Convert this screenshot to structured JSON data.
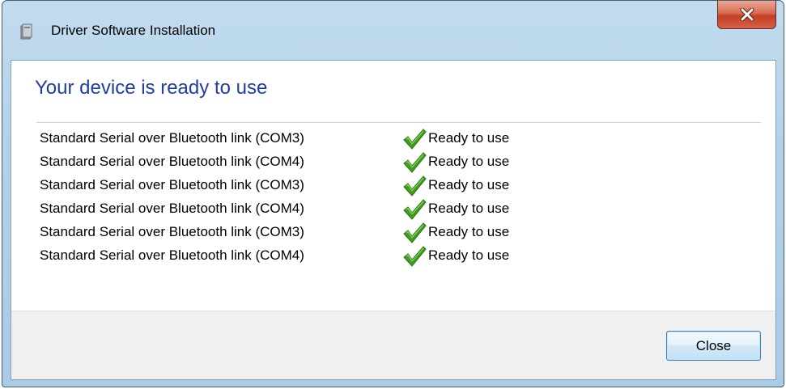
{
  "window": {
    "title": "Driver Software Installation",
    "close_icon": "close-x-icon",
    "app_icon": "driver-install-icon"
  },
  "main": {
    "heading": "Your device is ready to use",
    "devices": [
      {
        "name": "Standard Serial over Bluetooth link (COM3)",
        "status": "Ready to use",
        "status_icon": "check-icon"
      },
      {
        "name": "Standard Serial over Bluetooth link (COM4)",
        "status": "Ready to use",
        "status_icon": "check-icon"
      },
      {
        "name": "Standard Serial over Bluetooth link (COM3)",
        "status": "Ready to use",
        "status_icon": "check-icon"
      },
      {
        "name": "Standard Serial over Bluetooth link (COM4)",
        "status": "Ready to use",
        "status_icon": "check-icon"
      },
      {
        "name": "Standard Serial over Bluetooth link (COM3)",
        "status": "Ready to use",
        "status_icon": "check-icon"
      },
      {
        "name": "Standard Serial over Bluetooth link (COM4)",
        "status": "Ready to use",
        "status_icon": "check-icon"
      }
    ]
  },
  "footer": {
    "close_label": "Close"
  },
  "colors": {
    "heading": "#1e3f9f",
    "check": "#3f9e1c",
    "title_close": "#c43f23",
    "frame": "#b3d2ea"
  }
}
